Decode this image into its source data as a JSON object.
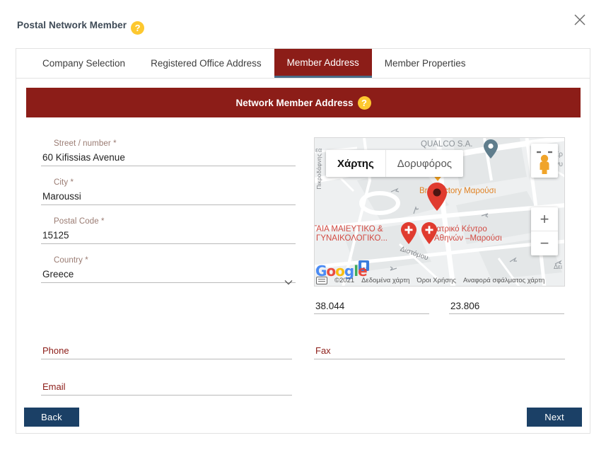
{
  "window": {
    "title": "Postal Network Member",
    "help_icon": "help-circle-icon",
    "help_glyph": "?",
    "close_icon": "close-icon"
  },
  "tabs": [
    {
      "label": "Company Selection",
      "active": false
    },
    {
      "label": "Registered Office Address",
      "active": false
    },
    {
      "label": "Member Address",
      "active": true
    },
    {
      "label": "Member Properties",
      "active": false
    }
  ],
  "banner": {
    "title": "Network Member Address",
    "help_glyph": "?",
    "color": "#8c1d18"
  },
  "form": {
    "street": {
      "label": "Street / number",
      "required": "*",
      "value": "60 Kifissias Avenue"
    },
    "city": {
      "label": "City",
      "required": "*",
      "value": "Maroussi"
    },
    "postal_code": {
      "label": "Postal Code",
      "required": "*",
      "value": "15125"
    },
    "country": {
      "label": "Country",
      "required": "*",
      "value": "Greece",
      "chevron_icon": "chevron-down-icon"
    },
    "phone": {
      "placeholder": "Phone",
      "value": ""
    },
    "fax": {
      "placeholder": "Fax",
      "value": ""
    },
    "email": {
      "placeholder": "Email",
      "value": ""
    }
  },
  "coordinates": {
    "latitude": "38.044",
    "longitude": "23.806"
  },
  "map": {
    "types": [
      {
        "label": "Χάρτης",
        "selected": true
      },
      {
        "label": "Δορυφόρος",
        "selected": false
      }
    ],
    "pegman_icon": "street-view-pegman-icon",
    "zoom_in": "+",
    "zoom_out": "−",
    "labels": {
      "qualco": "QUALCO S.A.",
      "marker_place": "Br    Factory Μαρούσι",
      "hospital_left_1": "ΓΑΙΑ ΜΑΙΕΥΤΙΚΟ &",
      "hospital_left_2": "ΓΥΝΑΙΚΟΛΟΓΙΚΟ...",
      "hospital_right_1": "Ιατρικό Κέντρο",
      "hospital_right_2": "Αθηνών –Μαρούσι",
      "street_distomou": "Διστόμου",
      "street_left_vertical": "Πικροδάφνης",
      "edge_left": "εα",
      "edge_right_1": "Ερ",
      "edge_right_2": "ιγυ",
      "edge_bottom_right": "Δει"
    },
    "footer": {
      "keyboard_icon": "keyboard-shortcuts-icon",
      "copyright": "©2021",
      "map_data": "Δεδομένα χάρτη",
      "terms": "Όροι Χρήσης",
      "report": "Αναφορά σφάλματος χάρτη"
    },
    "logo": {
      "g1": "G",
      "o1": "o",
      "o2": "o",
      "g2": "g",
      "l": "l",
      "e": "e"
    }
  },
  "footer": {
    "back_label": "Back",
    "next_label": "Next",
    "button_color": "#1b4066"
  }
}
